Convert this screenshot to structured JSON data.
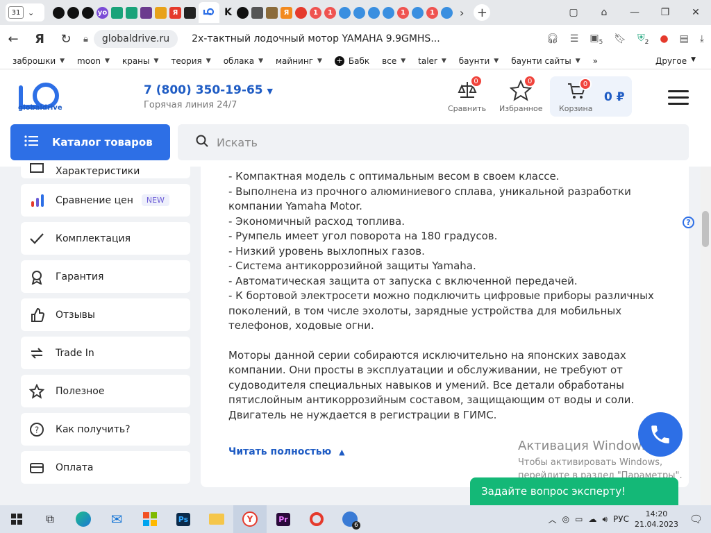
{
  "browser": {
    "tab_count": "31",
    "active_url_domain": "globaldrive.ru",
    "active_tab_title": "2х-тактный лодочный мотор YAMAHA 9.9GMHS...",
    "favicon_labels": [
      "",
      "",
      "",
      "yo",
      "",
      "",
      "",
      "",
      "Я",
      "",
      "K",
      "",
      "",
      "",
      "Я",
      "",
      "1",
      "1",
      "",
      "",
      "",
      "",
      "1",
      "",
      "1",
      ""
    ],
    "bookmarks": [
      "заброшки",
      "moon",
      "краны",
      "теория",
      "облака",
      "майнинг",
      "Бабк",
      "все",
      "taler",
      "баунти",
      "баунти сайты"
    ],
    "bookmarks_more": "»",
    "bookmarks_other": "Другое",
    "extension_badge": "5",
    "shield_badge": "2"
  },
  "header": {
    "logo_text": "globaldrive",
    "phone": "7 (800) 350-19-65",
    "hotline": "Горячая линия 24/7",
    "compare_label": "Сравнить",
    "compare_count": "0",
    "favorites_label": "Избранное",
    "favorites_count": "0",
    "cart_label": "Корзина",
    "cart_count": "0",
    "cart_sum": "0 ₽"
  },
  "catalog": {
    "button_label": "Каталог товаров",
    "search_placeholder": "Искать"
  },
  "sidebar": {
    "partial_item": "Характеристики",
    "items": [
      {
        "label": "Сравнение цен",
        "badge": "NEW"
      },
      {
        "label": "Комплектация"
      },
      {
        "label": "Гарантия"
      },
      {
        "label": "Отзывы"
      },
      {
        "label": "Trade In"
      },
      {
        "label": "Полезное"
      },
      {
        "label": "Как получить?"
      },
      {
        "label": "Оплата"
      }
    ]
  },
  "content": {
    "features": "- Компактная модель с оптимальным весом в своем классе.\n- Выполнена из прочного алюминиевого сплава, уникальной разработки компании Yamaha Motor.\n- Экономичный расход топлива.\n- Румпель имеет угол поворота на 180 градусов.\n- Низкий уровень выхлопных газов.\n- Система антикоррозийной защиты Yamaha.\n- Автоматическая защита от запуска с включенной передачей.\n- К бортовой электросети можно подключить цифровые приборы различных поколений, в том числе эхолоты, зарядные устройства для мобильных телефонов, ходовые огни.",
    "paragraph": "Моторы данной серии собираются исключительно на японских заводах компании. Они просты в эксплуатации и обслуживании, не требуют от судоводителя специальных навыков и умений. Все детали обработаны пятислойным антикоррозийным составом, защищающим от воды и соли. Двигатель не нуждается в регистрации в ГИМС.",
    "read_more": "Читать полностью"
  },
  "overlay": {
    "windows_title": "Активация Windows",
    "windows_line1": "Чтобы активировать Windows,",
    "windows_line2": "перейдите в раздел \"Параметры\".",
    "expert_button": "Задайте вопрос эксперту!",
    "help_glyph": "?"
  },
  "taskbar": {
    "lang": "РУС",
    "time": "14:20",
    "date": "21.04.2023",
    "badge_count": "6",
    "ps_label": "Ps",
    "pr_label": "Pr"
  },
  "colors": {
    "brand_blue": "#2d6fe6",
    "badge_red": "#f0443c",
    "expert_green": "#14b877"
  }
}
